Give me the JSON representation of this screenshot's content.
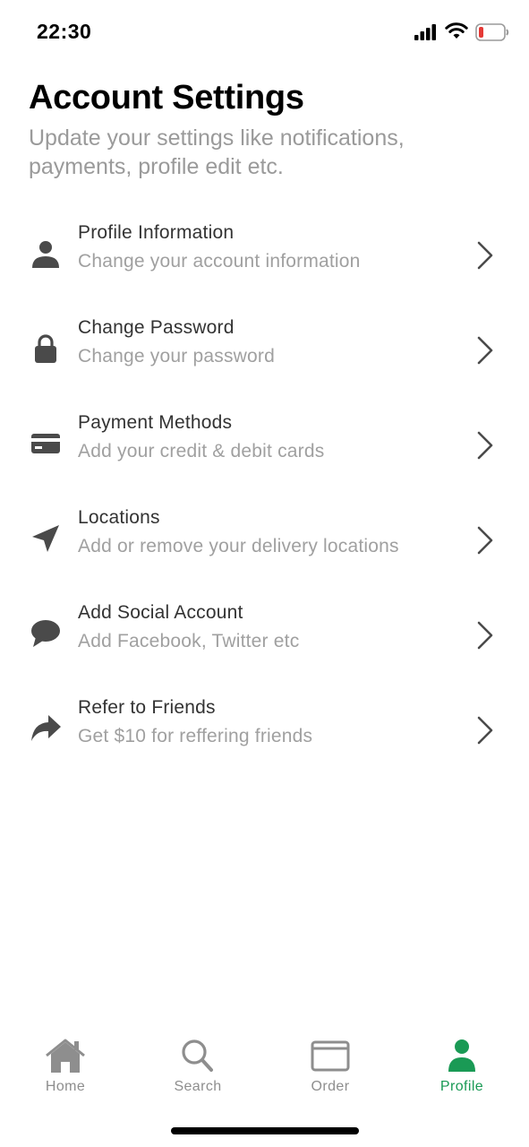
{
  "status_bar": {
    "time": "22:30"
  },
  "header": {
    "title": "Account Settings",
    "subtitle": "Update your settings like notifications, payments, profile edit etc."
  },
  "settings": [
    {
      "title": "Profile Information",
      "description": "Change your account information",
      "icon": "person-icon"
    },
    {
      "title": "Change Password",
      "description": "Change your password",
      "icon": "lock-icon"
    },
    {
      "title": "Payment Methods",
      "description": "Add your credit & debit cards",
      "icon": "credit-card-icon"
    },
    {
      "title": "Locations",
      "description": "Add or remove your delivery locations",
      "icon": "location-arrow-icon"
    },
    {
      "title": "Add Social Account",
      "description": "Add Facebook, Twitter etc",
      "icon": "chat-bubble-icon"
    },
    {
      "title": "Refer to Friends",
      "description": "Get $10 for reffering friends",
      "icon": "share-arrow-icon"
    }
  ],
  "tab_bar": {
    "tabs": [
      {
        "label": "Home",
        "icon": "home-icon",
        "active": false
      },
      {
        "label": "Search",
        "icon": "search-icon",
        "active": false
      },
      {
        "label": "Order",
        "icon": "order-icon",
        "active": false
      },
      {
        "label": "Profile",
        "icon": "person-icon",
        "active": true
      }
    ]
  },
  "colors": {
    "accent": "#1a9a55",
    "icon": "#4a4a4a",
    "muted_text": "#a0a0a0",
    "battery_low": "#e53935"
  }
}
